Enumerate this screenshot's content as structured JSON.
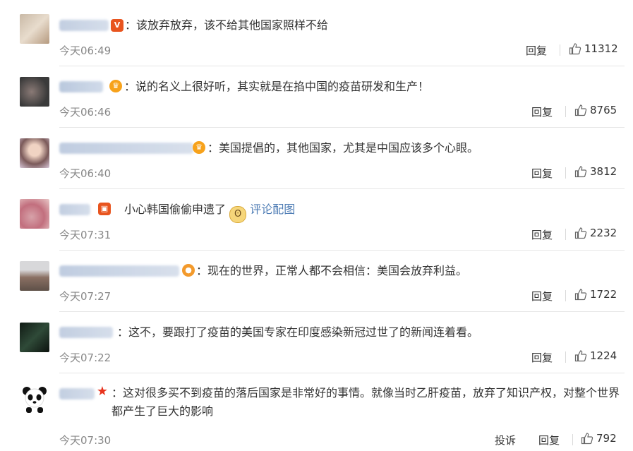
{
  "comments": [
    {
      "text": "：该放弃放弃，该不给其他国家照样不给",
      "time": "今天06:49",
      "reply": "回复",
      "likes": "11312",
      "badge": "V",
      "badge_color": "#e8541e"
    },
    {
      "text": "：说的名义上很好听，其实就是在掐中国的疫苗研发和生产！",
      "time": "今天06:46",
      "reply": "回复",
      "likes": "8765",
      "badge": "crown",
      "badge_color": "#f7a21b"
    },
    {
      "text": "：美国提倡的，其他国家，尤其是中国应该多个心眼。",
      "time": "今天06:40",
      "reply": "回复",
      "likes": "3812",
      "badge": "crown",
      "badge_color": "#f7a21b"
    },
    {
      "text": "小心韩国偷偷申遗了",
      "link": "评论配图",
      "time": "今天07:31",
      "reply": "回复",
      "likes": "2232",
      "badge": "red-square",
      "badge_color": "#e8541e"
    },
    {
      "text": "：现在的世界，正常人都不会相信：美国会放弃利益。",
      "time": "今天07:27",
      "reply": "回复",
      "likes": "1722",
      "badge": "orange-dot",
      "badge_color": "#f39a2c"
    },
    {
      "text": "：这不，要跟打了疫苗的美国专家在印度感染新冠过世了的新闻连着看。",
      "time": "今天07:22",
      "reply": "回复",
      "likes": "1224",
      "badge": "",
      "badge_color": ""
    },
    {
      "text": "：这对很多买不到疫苗的落后国家是非常好的事情。就像当时乙肝疫苗，放弃了知识产权，对整个世界都产生了巨大的影响",
      "time": "今天07:30",
      "reply": "回复",
      "report": "投诉",
      "likes": "792",
      "badge": "star",
      "badge_color": "#e8341e"
    }
  ],
  "icons": {
    "like": "thumbs-up-icon"
  }
}
